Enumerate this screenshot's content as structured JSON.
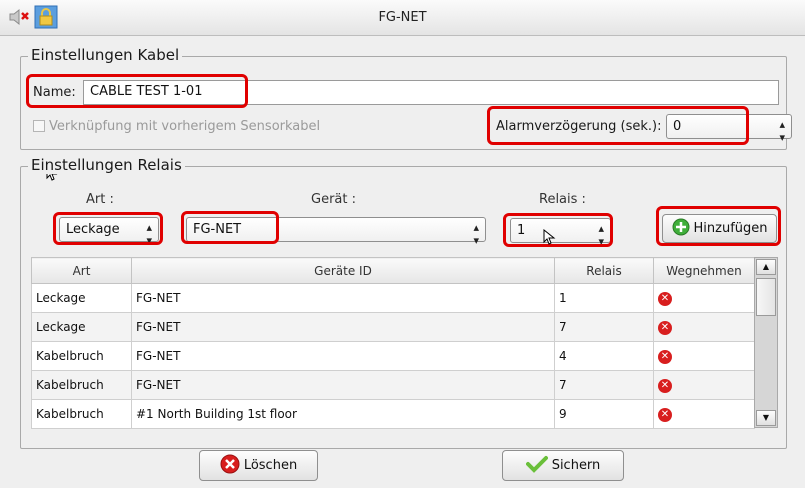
{
  "window": {
    "title": "FG-NET"
  },
  "kabel": {
    "legend": "Einstellungen Kabel",
    "name_label": "Name:",
    "name_value": "CABLE TEST 1-01",
    "checkbox_label": "Verknüpfung mit vorherigem Sensorkabel",
    "alarm_label": "Alarmverzögerung (sek.):",
    "alarm_value": "0"
  },
  "relais": {
    "legend": "Einstellungen Relais",
    "art_label": "Art :",
    "geraet_label": "Gerät :",
    "relais_label": "Relais :",
    "art_value": "Leckage",
    "geraet_value": "FG-NET",
    "relais_value": "1",
    "add_button": "Hinzufügen"
  },
  "table": {
    "headers": [
      "Art",
      "Geräte ID",
      "Relais",
      "Wegnehmen"
    ],
    "rows": [
      [
        "Leckage",
        "FG-NET",
        "1"
      ],
      [
        "Leckage",
        "FG-NET",
        "7"
      ],
      [
        "Kabelbruch",
        "FG-NET",
        "4"
      ],
      [
        "Kabelbruch",
        "FG-NET",
        "7"
      ],
      [
        "Kabelbruch",
        "#1 North Building 1st floor",
        "9"
      ]
    ]
  },
  "buttons": {
    "delete": "Löschen",
    "save": "Sichern"
  },
  "colors": {
    "highlight": "#e00000",
    "delete_icon": "#d81e1e",
    "add_icon": "#3fae3a",
    "save_icon": "#6abf3a"
  }
}
